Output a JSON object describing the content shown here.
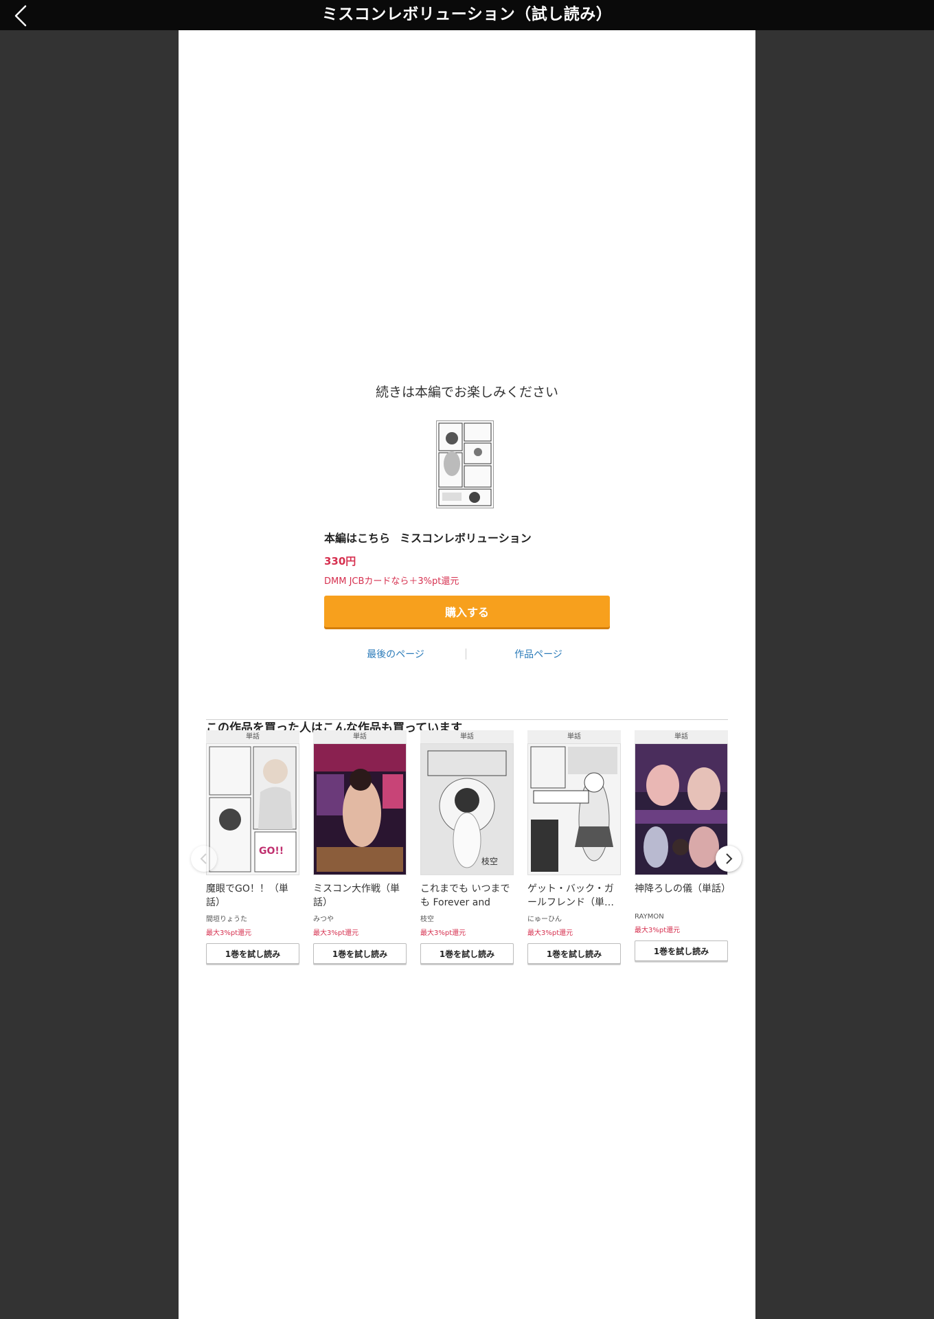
{
  "header": {
    "title": "ミスコンレボリューション（試し読み）",
    "back_icon": "chevron-left-icon"
  },
  "main": {
    "continue_text": "続きは本編でお楽しみください",
    "product_prefix": "本編はこちら",
    "product_name": "ミスコンレボリューション",
    "price": "330円",
    "promo": "DMM JCBカードなら＋3%pt還元",
    "buy_label": "購入する",
    "link_last_page": "最後のページ",
    "link_product_page": "作品ページ"
  },
  "recommend": {
    "heading": "この作品を買った人はこんな作品も買っています",
    "items": [
      {
        "badge": "単話",
        "title": "魔眼でGO！！（単話）",
        "author": "間垣りょうた",
        "promo": "最大3%pt還元",
        "button": "1巻を試し読み"
      },
      {
        "badge": "単話",
        "title": "ミスコン大作戦（単話）",
        "author": "みつや",
        "promo": "最大3%pt還元",
        "button": "1巻を試し読み"
      },
      {
        "badge": "単話",
        "title": "これまでも いつまでも Forever and eve…",
        "author": "枝空",
        "promo": "最大3%pt還元",
        "button": "1巻を試し読み"
      },
      {
        "badge": "単話",
        "title": "ゲット・バック・ガールフレンド（単…",
        "author": "にゅーひん",
        "promo": "最大3%pt還元",
        "button": "1巻を試し読み"
      },
      {
        "badge": "単話",
        "title": "神降ろしの儀（単話）",
        "author": "RAYMON",
        "promo": "最大3%pt還元",
        "button": "1巻を試し読み"
      }
    ]
  },
  "colors": {
    "accent": "#f7a01d",
    "price": "#d6304f",
    "link": "#2b7bb9",
    "background": "#333333"
  }
}
